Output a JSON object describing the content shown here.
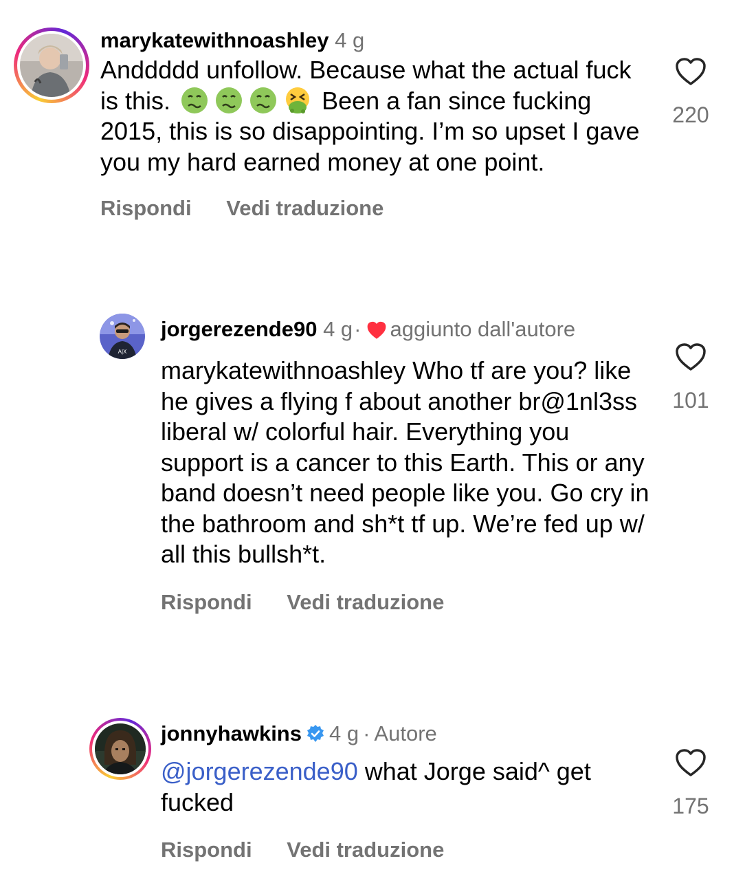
{
  "comments": [
    {
      "username": "marykatewithnoashley",
      "time": "4 g",
      "text_before_emoji": "Anddddd unfollow. Because what the actual fuck is this.",
      "emojis": [
        "nauseated-face",
        "nauseated-face",
        "nauseated-face",
        "vomiting-face"
      ],
      "text_after_emoji": "Been a fan since fucking 2015, this is so disappointing. I’m so upset I gave you my hard earned money at one point.",
      "reply_label": "Rispondi",
      "translate_label": "Vedi traduzione",
      "likes": "220",
      "avatar_ring": true
    },
    {
      "username": "jorgerezende90",
      "time": "4 g",
      "separator": "·",
      "badge_text": "aggiunto dall'autore",
      "badge_icon": "heart-icon",
      "text": "marykatewithnoashley Who tf are you? like he gives a flying f about another br@1nl3ss liberal w/ colorful hair. Everything you support is a cancer to this Earth. This or any band doesn’t need people like you. Go cry in the bathroom and sh*t tf up. We’re fed up w/ all this bullsh*t.",
      "reply_label": "Rispondi",
      "translate_label": "Vedi traduzione",
      "likes": "101",
      "avatar_ring": false
    },
    {
      "username": "jonnyhawkins",
      "verified": true,
      "time": "4 g",
      "separator": "·",
      "badge_text": "Autore",
      "mention": "@jorgerezende90",
      "text": " what Jorge said^ get fucked",
      "reply_label": "Rispondi",
      "translate_label": "Vedi traduzione",
      "likes": "175",
      "avatar_ring": true
    }
  ],
  "colors": {
    "meta_gray": "#737373",
    "mention_blue": "#3a5fc8",
    "heart_red": "#ff3040",
    "verified_blue": "#3897f0"
  }
}
